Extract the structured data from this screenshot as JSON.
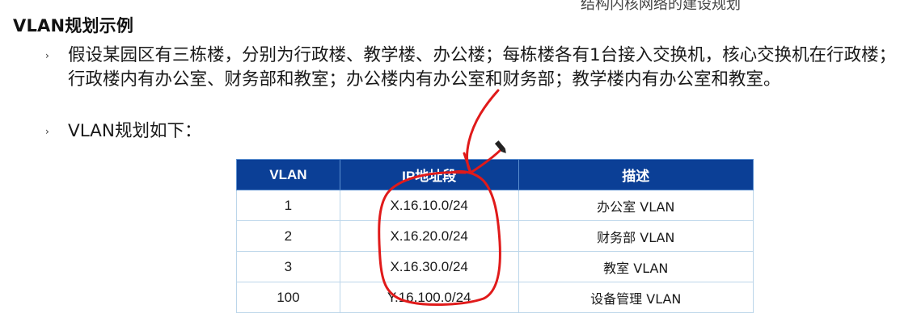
{
  "slide": {
    "top_fragment": "结构内核网络的建设规划",
    "title": "VLAN规划示例",
    "bullets": [
      "假设某园区有三栋楼，分别为行政楼、教学楼、办公楼；每栋楼各有1台接入交换机，核心交换机在行政楼；行政楼内有办公室、财务部和教室；办公楼内有办公室和财务部；教学楼内有办公室和教室。",
      "VLAN规划如下："
    ],
    "bullet_marker": "›"
  },
  "table": {
    "headers": [
      "VLAN",
      "IP地址段",
      "描述"
    ],
    "rows": [
      [
        "1",
        "X.16.10.0/24",
        "办公室 VLAN"
      ],
      [
        "2",
        "X.16.20.0/24",
        "财务部 VLAN"
      ],
      [
        "3",
        "X.16.30.0/24",
        "教室 VLAN"
      ],
      [
        "100",
        "Y.16.100.0/24",
        "设备管理 VLAN"
      ]
    ],
    "header_color": "#0b3f96",
    "border_color": "#bcd6ea"
  },
  "annotation": {
    "ink_color": "#e01a1a",
    "pen_icon": "pen-cursor-icon"
  }
}
